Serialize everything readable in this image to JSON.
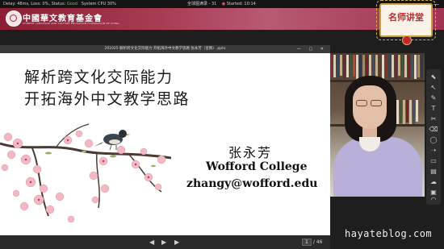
{
  "status_bar": {
    "network_prefix": "Delay: 48ms, Loss: 0%, Status:",
    "network_status": "Good",
    "cpu": "System CPU 30%",
    "meeting_title": "全球图满录 - 31",
    "recording_label": "Started: 10:14",
    "minimize_glyph": "—"
  },
  "banner": {
    "org_name": "中國華文教育基金會",
    "org_subtitle": "CHINESE LANGUAGE AND CULTURE EDUCATION FOUNDATION OF CHINA",
    "badge_text": "名师讲堂"
  },
  "document": {
    "file_title": "201025  解析跨文化交际能力  开拓海外中文教学思路  张永芳（宣稿）.pptx",
    "window_controls": "— ▢ ✕"
  },
  "slide": {
    "title_line1": "解析跨文化交际能力",
    "title_line2": "开拓海外中文教学思路",
    "speaker_name": "张永芳",
    "institution": "Wofford College",
    "email": "zhangy@wofford.edu"
  },
  "slide_controls": {
    "prev_glyph": "◀",
    "play_glyph": "▶",
    "next_glyph": "▶",
    "current_page": "1",
    "total_pages": "/ 46"
  },
  "toolbar": {
    "tools": [
      {
        "icon": "pointer-icon",
        "glyph": "⬉"
      },
      {
        "icon": "select-icon",
        "glyph": "↖"
      },
      {
        "icon": "pen-icon",
        "glyph": "✎"
      },
      {
        "icon": "text-icon",
        "glyph": "T"
      },
      {
        "icon": "scissors-icon",
        "glyph": "✂"
      },
      {
        "icon": "eraser-icon",
        "glyph": "⌫"
      },
      {
        "icon": "shape-icon",
        "glyph": "◯"
      },
      {
        "icon": "arrow-icon",
        "glyph": "➝"
      },
      {
        "icon": "comment-icon",
        "glyph": "▭"
      },
      {
        "icon": "chat-icon",
        "glyph": "▤"
      },
      {
        "icon": "cloud-icon",
        "glyph": "☁"
      },
      {
        "icon": "screen-icon",
        "glyph": "▣"
      },
      {
        "icon": "headset-icon",
        "glyph": "◠"
      }
    ]
  },
  "watermark": "hayateblog.com",
  "colors": {
    "banner_red": "#a83a52",
    "status_good": "#4ad25a",
    "recording_red": "#e04a4a",
    "badge_gold": "#c9a040",
    "shirt_lavender": "#b8b0d8"
  }
}
